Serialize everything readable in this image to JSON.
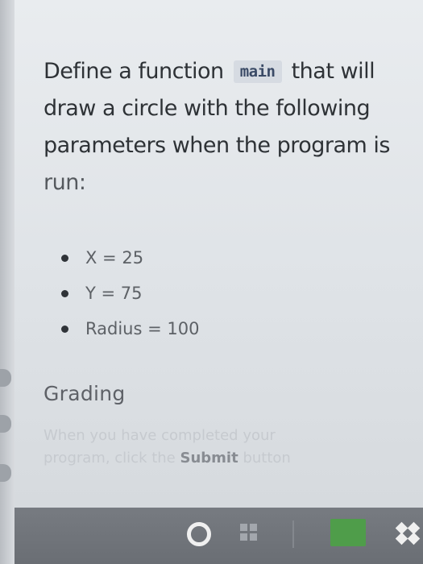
{
  "task": {
    "intro_before_code": "Define a function",
    "function_name": "main",
    "intro_line1_end": "that will",
    "intro_line2": "draw a circle with the following",
    "intro_line3": "parameters when the program is",
    "intro_line4": "run:",
    "parameters": [
      "X = 25",
      "Y = 75",
      "Radius = 100"
    ]
  },
  "grading": {
    "heading": "Grading",
    "text_line1": "When you have completed your",
    "text_line2_start": "program, click the",
    "submit_label": "Submit",
    "text_line2_end": "button"
  },
  "taskbar": {
    "icons": [
      "cortana-circle-icon",
      "task-view-icon",
      "app-green-icon",
      "dropbox-icon"
    ]
  }
}
